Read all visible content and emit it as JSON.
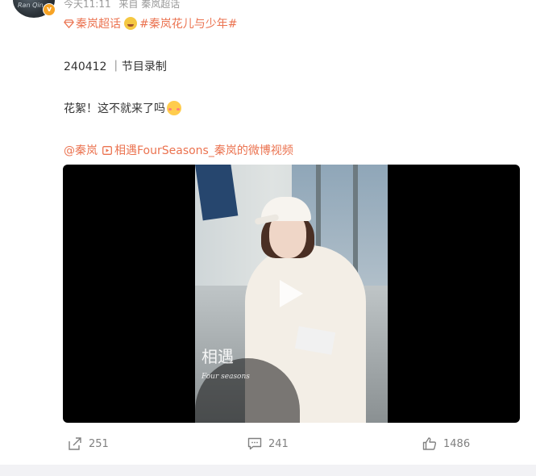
{
  "post": {
    "avatar_text": "Ran Qin",
    "meta": {
      "time": "今天11:11",
      "source": "来自 秦岚超话"
    },
    "tags": {
      "supertopic": "秦岚超话",
      "topic": "#秦岚花儿与少年#"
    },
    "text_line1": "240412 ｜节目录制",
    "text_line2": "花絮！这不就来了吗",
    "links": {
      "mention": "@秦岚",
      "video_link": "相遇FourSeasons_秦岚的微博视频"
    },
    "video": {
      "watermark": "相遇",
      "watermark_sub": "Four seasons"
    },
    "actions": {
      "forward_count": "251",
      "comment_count": "241",
      "like_count": "1486"
    }
  },
  "colors": {
    "accent": "#eb7350",
    "meta_text": "#999999",
    "body_text": "#333333",
    "badge": "#f7a325"
  }
}
